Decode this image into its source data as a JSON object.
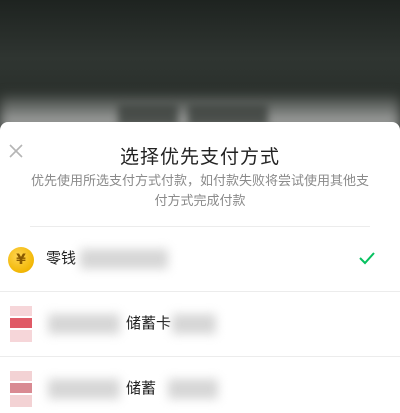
{
  "sheet": {
    "title": "选择优先支付方式",
    "description": "优先使用所选支付方式付款，如付款失败将尝试使用其他支付方式完成付款"
  },
  "methods": [
    {
      "label": "零钱",
      "icon": "coin-icon",
      "selected": true
    },
    {
      "label": "储蓄卡",
      "icon": "bank-card-icon",
      "selected": false
    },
    {
      "label": "储蓄",
      "icon": "bank-card-icon",
      "selected": false
    }
  ],
  "colors": {
    "accent_check": "#07c160",
    "coin": "#f2b705",
    "bank_red": "#e05a66"
  }
}
